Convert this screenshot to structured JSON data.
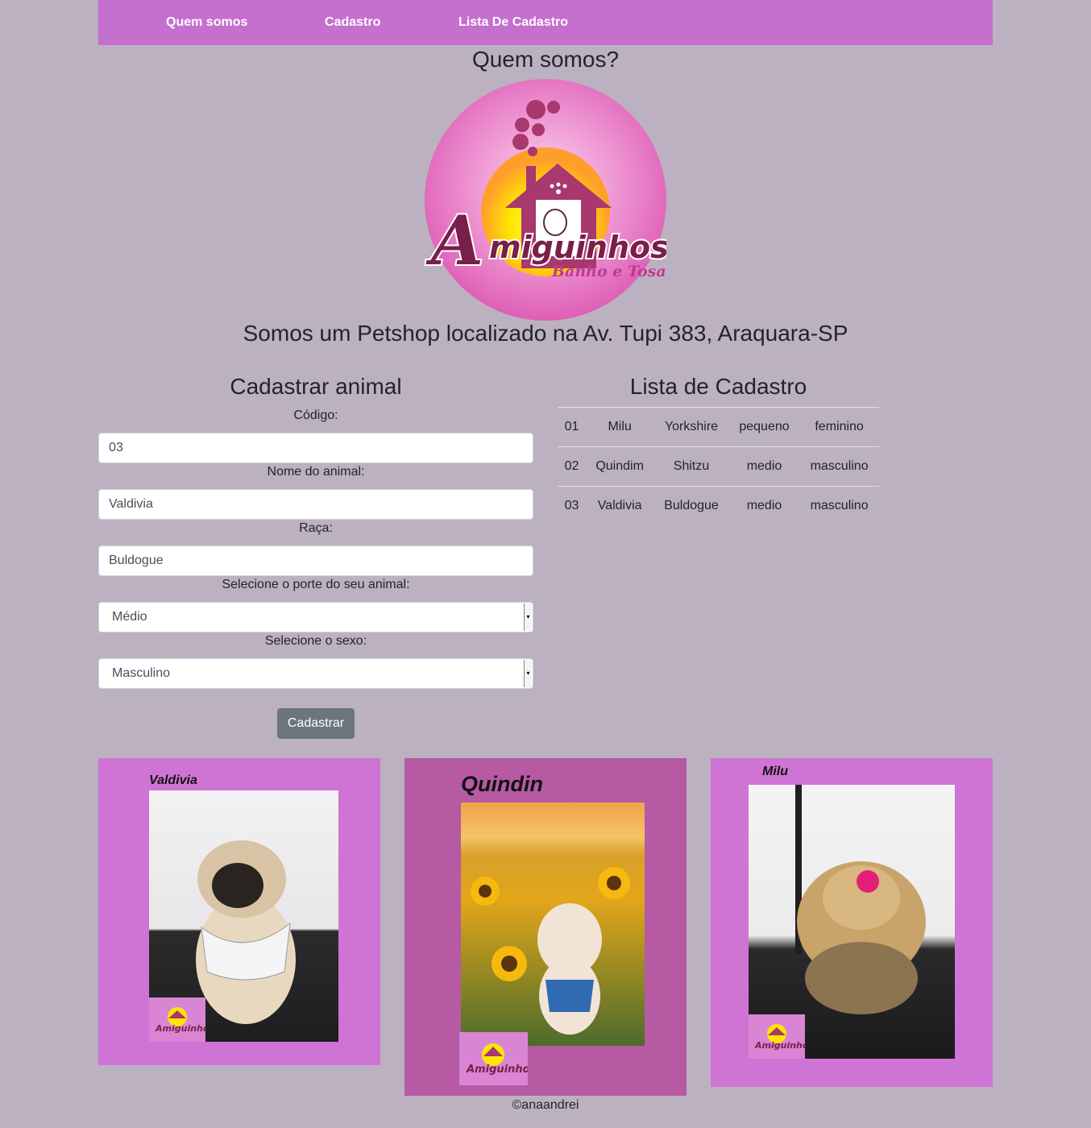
{
  "nav": {
    "items": [
      {
        "label": "Quem somos"
      },
      {
        "label": "Cadastro"
      },
      {
        "label": "Lista De Cadastro"
      }
    ]
  },
  "about": {
    "title": "Quem somos?",
    "logo": {
      "brand_big": "A",
      "brand": "miguinhos",
      "sub": "Banho e Tosa"
    },
    "tagline": "Somos um Petshop localizado na Av. Tupi 383, Araquara-SP"
  },
  "form": {
    "title": "Cadastrar animal",
    "codigo_label": "Código:",
    "codigo_value": "03",
    "nome_label": "Nome do animal:",
    "nome_value": "Valdivia",
    "raca_label": "Raça:",
    "raca_value": "Buldogue",
    "porte_label": "Selecione o porte do seu animal:",
    "porte_value": "Médio",
    "sexo_label": "Selecione o sexo:",
    "sexo_value": "Masculino",
    "submit_label": "Cadastrar"
  },
  "list": {
    "title": "Lista de Cadastro",
    "rows": [
      [
        "01",
        "Milu",
        "Yorkshire",
        "pequeno",
        "feminino"
      ],
      [
        "02",
        "Quindim",
        "Shitzu",
        "medio",
        "masculino"
      ],
      [
        "03",
        "Valdivia",
        "Buldogue",
        "medio",
        "masculino"
      ]
    ]
  },
  "gallery": [
    {
      "name": "Valdivia",
      "stamp": "Amiguinhos"
    },
    {
      "name": "Quindin",
      "stamp": "Amiguinhos"
    },
    {
      "name": "Milu",
      "stamp": "Amiguinhos"
    }
  ],
  "footer": {
    "text": "©anaandrei"
  },
  "colors": {
    "background": "#bcb1c1",
    "navbar": "#c56fcf",
    "button": "#6c757d",
    "card_1": "#cf74d4",
    "card_2": "#b55aa3",
    "card_3": "#cf74d4"
  }
}
